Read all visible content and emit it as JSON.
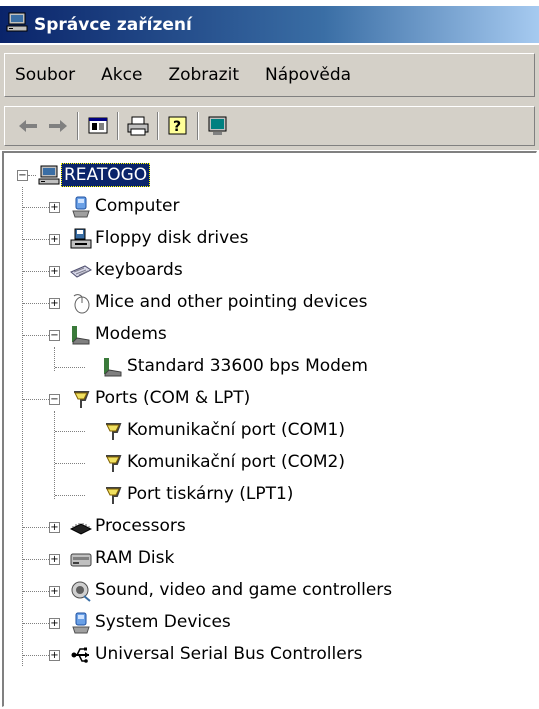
{
  "window": {
    "title": "Správce zařízení"
  },
  "menu": [
    "Soubor",
    "Akce",
    "Zobrazit",
    "Nápověda"
  ],
  "toolbar": {
    "buttons": [
      "back-icon",
      "forward-icon",
      "properties-icon",
      "print-icon",
      "help-icon",
      "scan-hardware-icon"
    ]
  },
  "tree": {
    "root": "REATOGO",
    "categories": [
      {
        "label": "Computer",
        "icon": "computer-icon",
        "expanded": false
      },
      {
        "label": "Floppy disk drives",
        "icon": "floppy-drive-icon",
        "expanded": false
      },
      {
        "label": "keyboards",
        "icon": "keyboard-icon",
        "expanded": false
      },
      {
        "label": "Mice and other pointing devices",
        "icon": "mouse-icon",
        "expanded": false
      },
      {
        "label": "Modems",
        "icon": "modem-icon",
        "expanded": true,
        "children": [
          "Standard 33600 bps Modem"
        ]
      },
      {
        "label": "Ports (COM & LPT)",
        "icon": "port-icon",
        "expanded": true,
        "children": [
          "Komunikační port (COM1)",
          "Komunikační port (COM2)",
          "Port tiskárny (LPT1)"
        ]
      },
      {
        "label": "Processors",
        "icon": "processor-icon",
        "expanded": false
      },
      {
        "label": "RAM Disk",
        "icon": "ram-disk-icon",
        "expanded": false
      },
      {
        "label": "Sound, video and game controllers",
        "icon": "sound-icon",
        "expanded": false
      },
      {
        "label": "System Devices",
        "icon": "system-devices-icon",
        "expanded": false
      },
      {
        "label": "Universal Serial Bus Controllers",
        "icon": "usb-icon",
        "expanded": false
      }
    ]
  },
  "expander": {
    "plus": "+",
    "minus": "−"
  }
}
